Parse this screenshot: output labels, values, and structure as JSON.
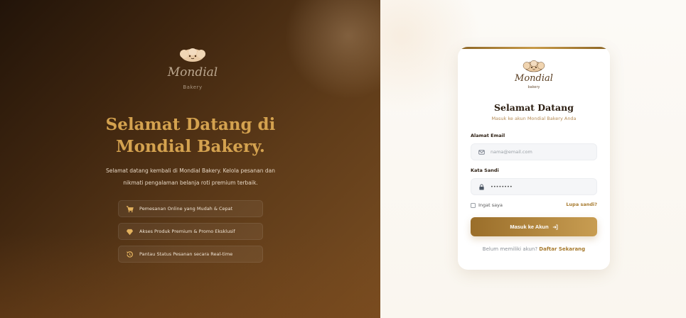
{
  "brand": {
    "name": "Mondial",
    "tagline": "Bakery",
    "tagline_card": "bakery"
  },
  "hero": {
    "title_line1": "Selamat Datang di",
    "title_line2": "Mondial Bakery.",
    "desc_line1": "Selamat datang kembali di Mondial Bakery. Kelola pesanan dan",
    "desc_line2": "nikmati pengalaman belanja roti premium terbaik."
  },
  "features": [
    {
      "icon": "cart-icon",
      "label": "Pemesanan Online yang Mudah & Cepat"
    },
    {
      "icon": "gem-icon",
      "label": "Akses Produk Premium & Promo Eksklusif"
    },
    {
      "icon": "history-icon",
      "label": "Pantau Status Pesanan secara Real-time"
    }
  ],
  "login": {
    "title": "Selamat Datang",
    "subtitle": "Masuk ke akun Mondial Bakery Anda",
    "email_label": "Alamat Email",
    "email_placeholder": "nama@email.com",
    "password_label": "Kata Sandi",
    "password_value": "••••••••",
    "remember_label": "Ingat saya",
    "forgot_label": "Lupa sandi?",
    "submit_label": "Masuk ke Akun",
    "register_prompt": "Belum memiliki akun?",
    "register_link": "Daftar Sekarang"
  },
  "colors": {
    "accent_gold": "#c79a48",
    "hero_title": "#d4a24f",
    "panel_dark": "#3e250f"
  }
}
